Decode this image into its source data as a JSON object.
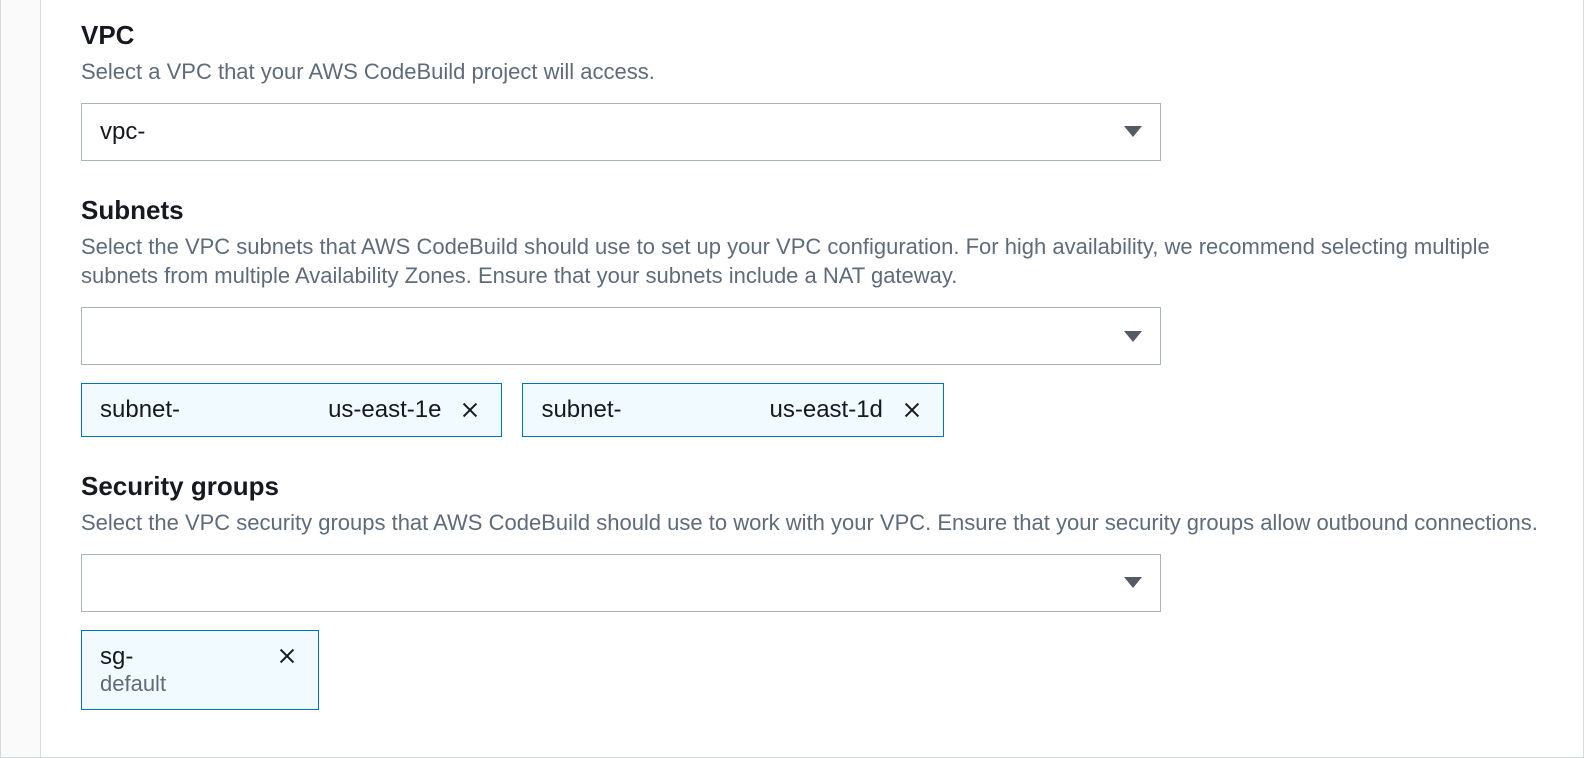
{
  "vpc": {
    "title": "VPC",
    "description": "Select a VPC that your AWS CodeBuild project will access.",
    "selected": "vpc-"
  },
  "subnets": {
    "title": "Subnets",
    "description": "Select the VPC subnets that AWS CodeBuild should use to set up your VPC configuration. For high availability, we recommend selecting multiple subnets from multiple Availability Zones. Ensure that your subnets include a NAT gateway.",
    "selected": "",
    "chips": [
      {
        "id": "subnet-",
        "zone": "us-east-1e"
      },
      {
        "id": "subnet-",
        "zone": "us-east-1d"
      }
    ]
  },
  "security_groups": {
    "title": "Security groups",
    "description": "Select the VPC security groups that AWS CodeBuild should use to work with your VPC. Ensure that your security groups allow outbound connections.",
    "selected": "",
    "chips": [
      {
        "id": "sg-",
        "sub": "default"
      }
    ]
  }
}
